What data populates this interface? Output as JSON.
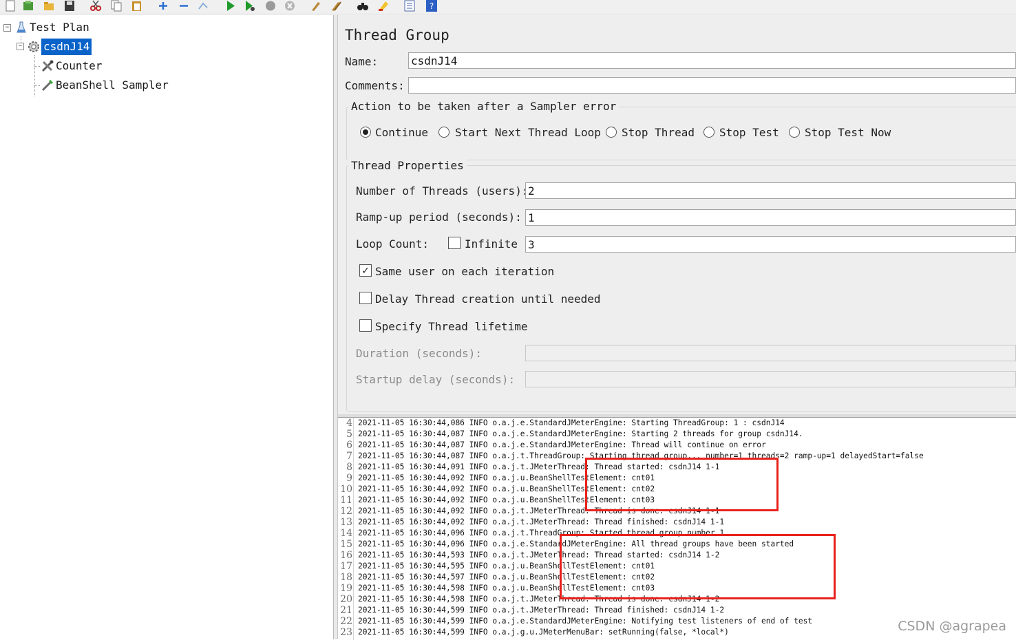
{
  "toolbar": {
    "icons": [
      "new-icon",
      "templates-icon",
      "open-icon",
      "save-icon",
      "cut-icon",
      "copy-icon",
      "paste-icon",
      "expand-icon",
      "collapse-icon",
      "toggle-icon",
      "start-icon",
      "start-no-pauses-icon",
      "stop-icon",
      "shutdown-icon",
      "clear-icon",
      "clear-all-icon",
      "search-icon",
      "reset-search-icon",
      "function-helper-icon",
      "help-icon"
    ]
  },
  "tree": {
    "items": [
      {
        "label": "Test Plan",
        "icon": "test-plan-icon"
      },
      {
        "label": "csdnJ14",
        "icon": "thread-group-icon",
        "selected": true
      },
      {
        "label": "Counter",
        "icon": "counter-icon"
      },
      {
        "label": "BeanShell Sampler",
        "icon": "sampler-icon"
      }
    ]
  },
  "panel": {
    "title": "Thread Group",
    "name_label": "Name:",
    "name_value": "csdnJ14",
    "comments_label": "Comments:",
    "comments_value": "",
    "action_group_title": "Action to be taken after a Sampler error",
    "actions": [
      {
        "label": "Continue",
        "selected": true
      },
      {
        "label": "Start Next Thread Loop",
        "selected": false
      },
      {
        "label": "Stop Thread",
        "selected": false
      },
      {
        "label": "Stop Test",
        "selected": false
      },
      {
        "label": "Stop Test Now",
        "selected": false
      }
    ],
    "props_group_title": "Thread Properties",
    "threads_label": "Number of Threads (users):",
    "threads_value": "2",
    "rampup_label": "Ramp-up period (seconds):",
    "rampup_value": "1",
    "loop_label": "Loop Count:",
    "infinite_label": "Infinite",
    "infinite_checked": false,
    "loop_value": "3",
    "same_user_label": "Same user on each iteration",
    "same_user_checked": true,
    "delay_label": "Delay Thread creation until needed",
    "delay_checked": false,
    "lifetime_label": "Specify Thread lifetime",
    "lifetime_checked": false,
    "duration_label": "Duration (seconds):",
    "duration_value": "",
    "startup_label": "Startup delay (seconds):",
    "startup_value": ""
  },
  "log": {
    "line_numbers": [
      "4",
      "5",
      "6",
      "7",
      "8",
      "9",
      "10",
      "11",
      "12",
      "13",
      "14",
      "15",
      "16",
      "17",
      "18",
      "19",
      "20",
      "21",
      "22",
      "23"
    ],
    "lines": [
      "2021-11-05 16:30:44,086 INFO o.a.j.e.StandardJMeterEngine: Starting ThreadGroup: 1 : csdnJ14",
      "2021-11-05 16:30:44,087 INFO o.a.j.e.StandardJMeterEngine: Starting 2 threads for group csdnJ14.",
      "2021-11-05 16:30:44,087 INFO o.a.j.e.StandardJMeterEngine: Thread will continue on error",
      "2021-11-05 16:30:44,087 INFO o.a.j.t.ThreadGroup: Starting thread group... number=1 threads=2 ramp-up=1 delayedStart=false",
      "2021-11-05 16:30:44,091 INFO o.a.j.t.JMeterThread: Thread started: csdnJ14 1-1",
      "2021-11-05 16:30:44,092 INFO o.a.j.u.BeanShellTestElement: cnt01",
      "2021-11-05 16:30:44,092 INFO o.a.j.u.BeanShellTestElement: cnt02",
      "2021-11-05 16:30:44,092 INFO o.a.j.u.BeanShellTestElement: cnt03",
      "2021-11-05 16:30:44,092 INFO o.a.j.t.JMeterThread: Thread is done: csdnJ14 1-1",
      "2021-11-05 16:30:44,092 INFO o.a.j.t.JMeterThread: Thread finished: csdnJ14 1-1",
      "2021-11-05 16:30:44,096 INFO o.a.j.t.ThreadGroup: Started thread group number 1",
      "2021-11-05 16:30:44,096 INFO o.a.j.e.StandardJMeterEngine: All thread groups have been started",
      "2021-11-05 16:30:44,593 INFO o.a.j.t.JMeterThread: Thread started: csdnJ14 1-2",
      "2021-11-05 16:30:44,595 INFO o.a.j.u.BeanShellTestElement: cnt01",
      "2021-11-05 16:30:44,597 INFO o.a.j.u.BeanShellTestElement: cnt02",
      "2021-11-05 16:30:44,598 INFO o.a.j.u.BeanShellTestElement: cnt03",
      "2021-11-05 16:30:44,598 INFO o.a.j.t.JMeterThread: Thread is done: csdnJ14 1-2",
      "2021-11-05 16:30:44,599 INFO o.a.j.t.JMeterThread: Thread finished: csdnJ14 1-2",
      "2021-11-05 16:30:44,599 INFO o.a.j.e.StandardJMeterEngine: Notifying test listeners of end of test",
      "2021-11-05 16:30:44,599 INFO o.a.j.g.u.JMeterMenuBar: setRunning(false, *local*)"
    ]
  },
  "annotation_color": "#e8211b",
  "watermark": "CSDN @agrapea"
}
